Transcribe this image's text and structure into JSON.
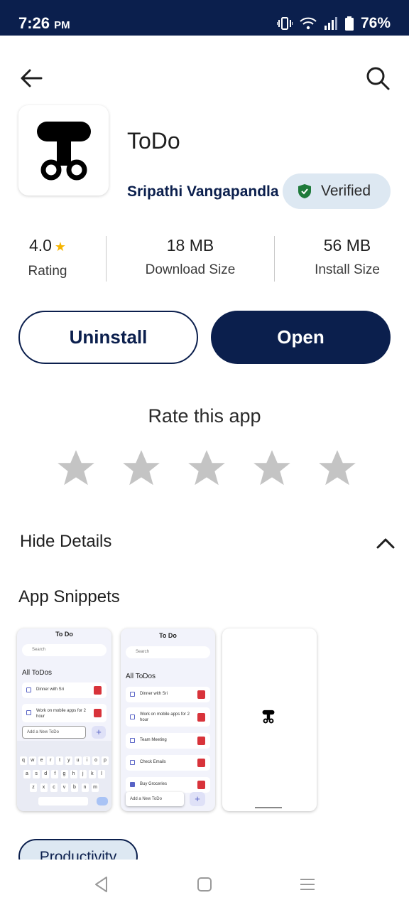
{
  "status_bar": {
    "time": "7:26",
    "ampm": "PM",
    "battery": "76%"
  },
  "app": {
    "title": "ToDo",
    "developer": "Sripathi Vangapandla",
    "verified_label": "Verified"
  },
  "stats": {
    "rating_value": "4.0",
    "rating_label": "Rating",
    "download_size_value": "18 MB",
    "download_size_label": "Download Size",
    "install_size_value": "56 MB",
    "install_size_label": "Install Size"
  },
  "actions": {
    "uninstall_label": "Uninstall",
    "open_label": "Open"
  },
  "rate": {
    "title": "Rate this app",
    "stars": 5
  },
  "details": {
    "toggle_label": "Hide Details"
  },
  "snippets": {
    "title": "App Snippets",
    "screens": [
      {
        "header": "To Do",
        "search": "Search",
        "list_title": "All ToDos",
        "items": [
          "Dinner with Sri",
          "Work on mobile apps for 2 hour"
        ],
        "input_placeholder": "Add a New ToDo",
        "keyboard_rows": [
          [
            "q",
            "w",
            "e",
            "r",
            "t",
            "y",
            "u",
            "i",
            "o",
            "p"
          ],
          [
            "a",
            "s",
            "d",
            "f",
            "g",
            "h",
            "j",
            "k",
            "l"
          ],
          [
            "z",
            "x",
            "c",
            "v",
            "b",
            "n",
            "m"
          ]
        ]
      },
      {
        "header": "To Do",
        "search": "Search",
        "list_title": "All ToDos",
        "items": [
          "Dinner with Sri",
          "Work on mobile apps for 2 hour",
          "Team Meeting",
          "Check Emails",
          "Buy Groceries"
        ],
        "input_placeholder": "Add a New ToDo"
      },
      {
        "header": ""
      }
    ]
  },
  "category_chip": "Productivity",
  "colors": {
    "primary": "#0b1f4d",
    "badge_bg": "#dde8f2",
    "star_empty": "#c4c4c4",
    "star_filled": "#f5b400",
    "shield": "#1e7a3a"
  },
  "icons": [
    "back-arrow-icon",
    "search-icon",
    "shield-check-icon",
    "star-icon",
    "chevron-up-icon",
    "nav-back-icon",
    "nav-home-icon",
    "nav-menu-icon"
  ]
}
